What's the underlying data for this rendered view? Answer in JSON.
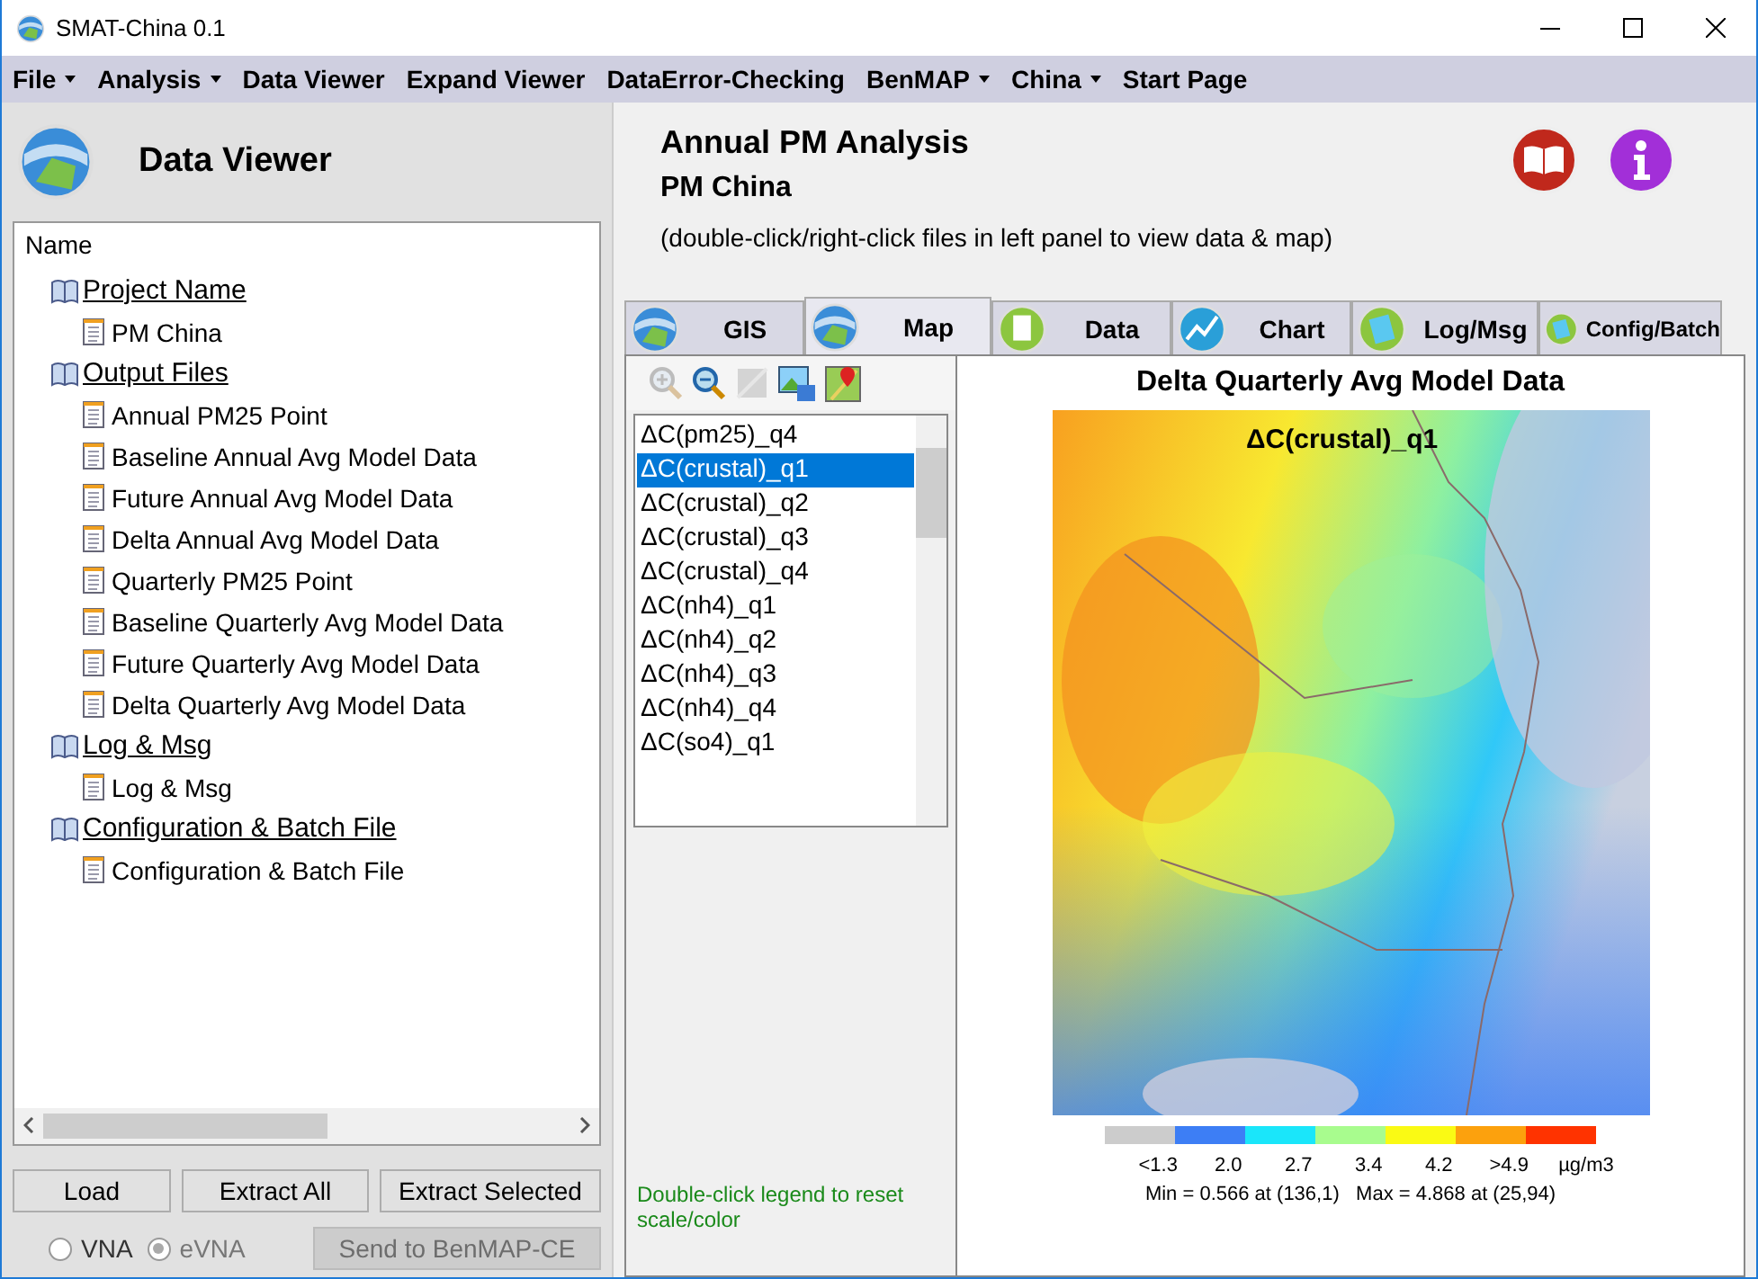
{
  "window": {
    "title": "SMAT-China 0.1"
  },
  "menu": [
    {
      "label": "File",
      "dropdown": true
    },
    {
      "label": "Analysis",
      "dropdown": true
    },
    {
      "label": "Data Viewer",
      "dropdown": false
    },
    {
      "label": "Expand Viewer",
      "dropdown": false
    },
    {
      "label": "DataError-Checking",
      "dropdown": false
    },
    {
      "label": "BenMAP",
      "dropdown": true
    },
    {
      "label": "China",
      "dropdown": true
    },
    {
      "label": "Start Page",
      "dropdown": false
    }
  ],
  "sidebar": {
    "title": "Data Viewer",
    "tree_header": "Name",
    "tree": [
      {
        "label": "Project Name",
        "children": [
          {
            "label": "PM China"
          }
        ]
      },
      {
        "label": "Output Files",
        "children": [
          {
            "label": "Annual PM25 Point"
          },
          {
            "label": "Baseline Annual Avg Model Data"
          },
          {
            "label": "Future Annual Avg Model Data"
          },
          {
            "label": "Delta Annual Avg Model Data"
          },
          {
            "label": "Quarterly PM25 Point"
          },
          {
            "label": "Baseline Quarterly Avg Model Data"
          },
          {
            "label": "Future Quarterly Avg Model Data"
          },
          {
            "label": "Delta Quarterly Avg Model Data"
          }
        ]
      },
      {
        "label": "Log & Msg",
        "children": [
          {
            "label": "Log & Msg"
          }
        ]
      },
      {
        "label": "Configuration & Batch File",
        "children": [
          {
            "label": "Configuration & Batch File"
          }
        ]
      }
    ],
    "buttons": [
      {
        "label": "Load",
        "disabled": false
      },
      {
        "label": "Extract All",
        "disabled": false
      },
      {
        "label": "Extract Selected",
        "disabled": false
      }
    ],
    "radios": [
      {
        "label": "VNA",
        "selected": false,
        "disabled": false
      },
      {
        "label": "eVNA",
        "selected": true,
        "disabled": true
      }
    ],
    "send_button": {
      "label": "Send to BenMAP-CE",
      "disabled": true
    }
  },
  "header": {
    "title": "Annual PM Analysis",
    "subtitle": "PM China",
    "hint": "(double-click/right-click files in left panel to view data & map)"
  },
  "tabs": [
    {
      "label": "GIS",
      "kind": "globe",
      "selected": false
    },
    {
      "label": "Map",
      "kind": "globe",
      "selected": true
    },
    {
      "label": "Data",
      "kind": "doc",
      "selected": false
    },
    {
      "label": "Chart",
      "kind": "chart",
      "selected": false
    },
    {
      "label": "Log/Msg",
      "kind": "note",
      "selected": false
    },
    {
      "label": "Config/Batch",
      "kind": "note",
      "selected": false
    }
  ],
  "toolbar": [
    {
      "kind": "zoom-in",
      "disabled": true
    },
    {
      "kind": "zoom-out",
      "disabled": false
    },
    {
      "kind": "pan",
      "disabled": true
    },
    {
      "kind": "save-image",
      "disabled": false
    },
    {
      "kind": "map-pin",
      "disabled": false
    }
  ],
  "variables": [
    {
      "label": "ΔC(pm25)_q4",
      "selected": false
    },
    {
      "label": "ΔC(crustal)_q1",
      "selected": true
    },
    {
      "label": "ΔC(crustal)_q2",
      "selected": false
    },
    {
      "label": "ΔC(crustal)_q3",
      "selected": false
    },
    {
      "label": "ΔC(crustal)_q4",
      "selected": false
    },
    {
      "label": "ΔC(nh4)_q1",
      "selected": false
    },
    {
      "label": "ΔC(nh4)_q2",
      "selected": false
    },
    {
      "label": "ΔC(nh4)_q3",
      "selected": false
    },
    {
      "label": "ΔC(nh4)_q4",
      "selected": false
    },
    {
      "label": "ΔC(so4)_q1",
      "selected": false
    }
  ],
  "legend_hint": "Double-click legend to reset scale/color",
  "map": {
    "title": "Delta Quarterly Avg Model Data",
    "overlay_label": "ΔC(crustal)_q1",
    "legend": {
      "swatches": [
        {
          "color": "#cccccc"
        },
        {
          "color": "#3d7ef5"
        },
        {
          "color": "#1ae6fa"
        },
        {
          "color": "#a8fc8e"
        },
        {
          "color": "#fafa14"
        },
        {
          "color": "#fca10d"
        },
        {
          "color": "#ff3300"
        }
      ],
      "labels": [
        "<1.3",
        "2.0",
        "2.7",
        "3.4",
        "4.2",
        ">4.9"
      ],
      "unit": "µg/m3"
    },
    "stats": "Min = 0.566 at (136,1)   Max = 4.868 at (25,94)"
  }
}
